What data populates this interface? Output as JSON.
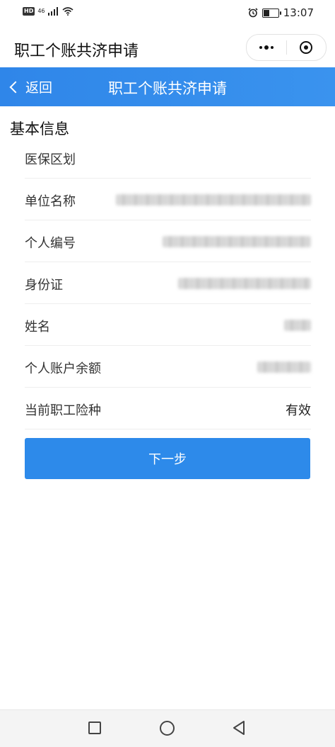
{
  "status_bar": {
    "left_badge": "HD",
    "network": "46",
    "time": "13:07",
    "battery_level_percent": 45
  },
  "mini_program": {
    "title": "职工个账共济申请"
  },
  "nav": {
    "back_label": "返回",
    "title": "职工个账共济申请"
  },
  "section": {
    "title": "基本信息"
  },
  "fields": [
    {
      "label": "医保区划",
      "value": ""
    },
    {
      "label": "单位名称",
      "value": ""
    },
    {
      "label": "个人编号",
      "value": ""
    },
    {
      "label": "身份证",
      "value": ""
    },
    {
      "label": "姓名",
      "value": ""
    },
    {
      "label": "个人账户余额",
      "value": ""
    },
    {
      "label": "当前职工险种",
      "value": "有效"
    }
  ],
  "actions": {
    "next_label": "下一步"
  },
  "colors": {
    "primary": "#2d8aea",
    "nav_bar": "#3a8fec"
  }
}
